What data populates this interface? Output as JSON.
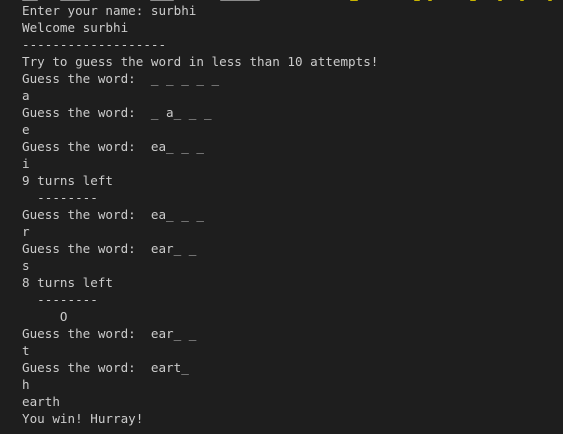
{
  "terminal": {
    "lines": [
      "Enter your name: surbhi",
      "Welcome surbhi",
      "-------------------",
      "Try to guess the word in less than 10 attempts!",
      "Guess the word:  _ _ _ _ _",
      "a",
      "Guess the word:  _ a_ _ _",
      "e",
      "Guess the word:  ea_ _ _",
      "i",
      "9 turns left",
      "  --------",
      "Guess the word:  ea_ _ _",
      "r",
      "Guess the word:  ear_ _",
      "s",
      "8 turns left",
      "  --------",
      "     O",
      "Guess the word:  ear_ _",
      "t",
      "Guess the word:  eart_",
      "h",
      "earth",
      "You win! Hurray!"
    ]
  },
  "colors": {
    "background": "#1e1e1e",
    "foreground": "#cccccc",
    "highlight_yellow": "#c8b400"
  }
}
